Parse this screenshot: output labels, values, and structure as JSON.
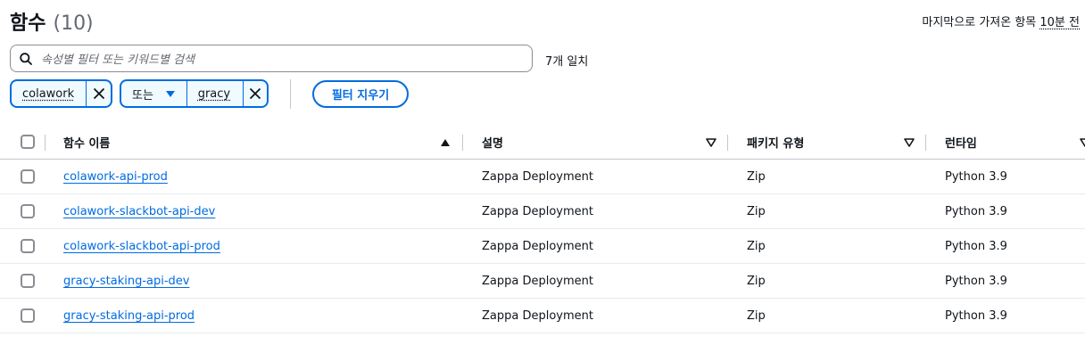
{
  "header": {
    "title": "함수",
    "count": "(10)"
  },
  "last_fetched": {
    "prefix": "마지막으로 가져온 항목 ",
    "ago": "10분 전"
  },
  "search": {
    "placeholder": "속성별 필터 또는 키워드별 검색",
    "match_count": "7개 일치"
  },
  "filters": {
    "tokens": [
      {
        "value": "colawork"
      },
      {
        "operator": "또는",
        "value": "gracy"
      }
    ],
    "clear_label": "필터 지우기"
  },
  "table": {
    "columns": {
      "name": "함수 이름",
      "description": "설명",
      "package_type": "패키지 유형",
      "runtime": "런타임"
    },
    "rows": [
      {
        "name": "colawork-api-prod",
        "description": "Zappa Deployment",
        "package_type": "Zip",
        "runtime": "Python 3.9"
      },
      {
        "name": "colawork-slackbot-api-dev",
        "description": "Zappa Deployment",
        "package_type": "Zip",
        "runtime": "Python 3.9"
      },
      {
        "name": "colawork-slackbot-api-prod",
        "description": "Zappa Deployment",
        "package_type": "Zip",
        "runtime": "Python 3.9"
      },
      {
        "name": "gracy-staking-api-dev",
        "description": "Zappa Deployment",
        "package_type": "Zip",
        "runtime": "Python 3.9"
      },
      {
        "name": "gracy-staking-api-prod",
        "description": "Zappa Deployment",
        "package_type": "Zip",
        "runtime": "Python 3.9"
      }
    ]
  },
  "icons": {
    "search": "search-icon",
    "close": "close-icon",
    "caret": "caret-down-icon",
    "sort_asc": "sort-ascending-icon",
    "sort_desc": "sort-descending-icon"
  },
  "colors": {
    "accent": "#006ce0",
    "text": "#0f141a",
    "muted": "#656871",
    "border": "#c6c6cd"
  }
}
